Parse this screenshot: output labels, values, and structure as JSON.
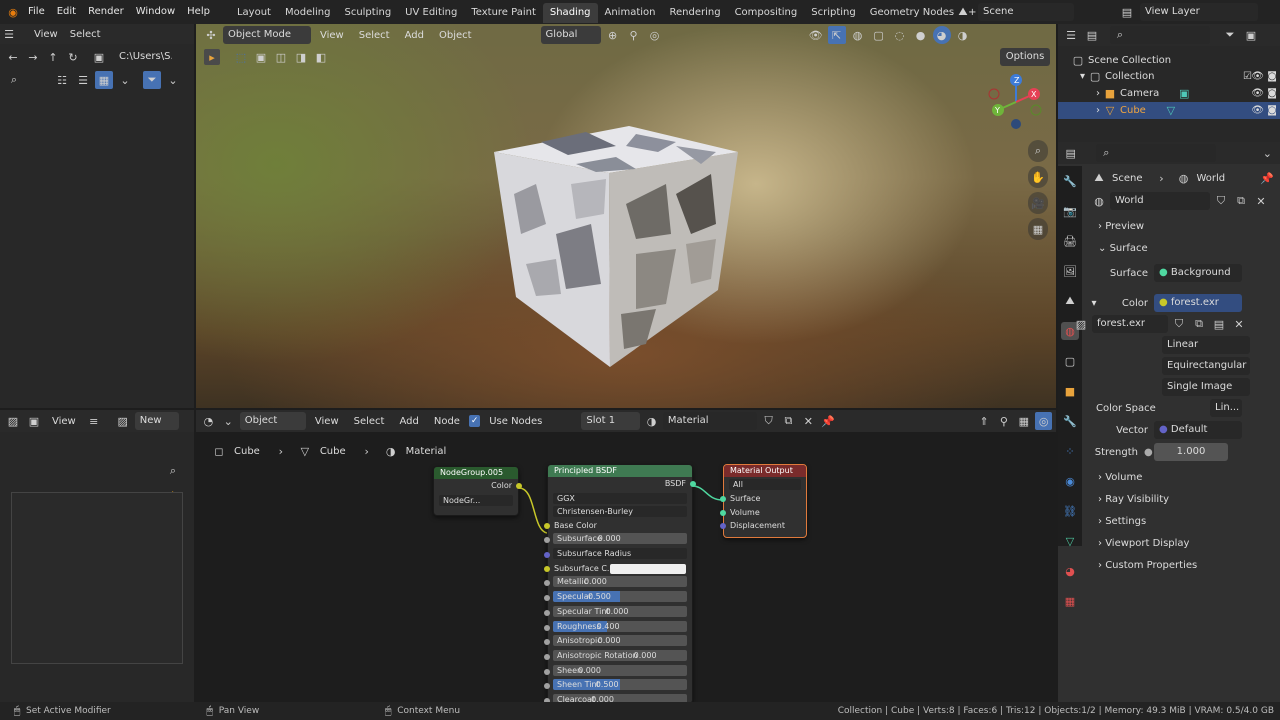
{
  "topbar": {
    "menus": [
      "File",
      "Edit",
      "Render",
      "Window",
      "Help"
    ],
    "tabs": [
      "Layout",
      "Modeling",
      "Sculpting",
      "UV Editing",
      "Texture Paint",
      "Shading",
      "Animation",
      "Rendering",
      "Compositing",
      "Scripting",
      "Geometry Nodes"
    ],
    "active_tab": "Shading",
    "add": "+",
    "scene": "Scene",
    "view_layer": "View Layer"
  },
  "filebrowser": {
    "menu": [
      "View",
      "Select"
    ],
    "path": "C:\\Users\\S..."
  },
  "viewport": {
    "mode": "Object Mode",
    "menus": [
      "View",
      "Select",
      "Add",
      "Object"
    ],
    "orientation": "Global",
    "options": "Options",
    "axis": {
      "x": "X",
      "y": "Y",
      "z": "Z"
    }
  },
  "imageeditor": {
    "view": "View",
    "new": "New"
  },
  "nodeeditor": {
    "type": "Object",
    "menus": [
      "View",
      "Select",
      "Add",
      "Node"
    ],
    "use_nodes": "Use Nodes",
    "slot": "Slot 1",
    "material": "Material",
    "breadcrumb": [
      "Cube",
      "Cube",
      "Material"
    ]
  },
  "nodes": {
    "group": {
      "title": "NodeGroup.005",
      "out": "Color",
      "sel": "NodeGr..."
    },
    "bsdf": {
      "title": "Principled BSDF",
      "out": "BSDF",
      "dist": "GGX",
      "sss": "Christensen-Burley",
      "base": "Base Color",
      "rows": [
        {
          "l": "Subsurface",
          "v": "0.000",
          "f": 0
        },
        {
          "l": "Subsurface Radius",
          "v": "",
          "f": -1
        },
        {
          "l": "Subsurface C...",
          "v": "",
          "f": -2
        },
        {
          "l": "Metallic",
          "v": "0.000",
          "f": 0
        },
        {
          "l": "Specular",
          "v": "0.500",
          "f": 0.5
        },
        {
          "l": "Specular Tint",
          "v": "0.000",
          "f": 0
        },
        {
          "l": "Roughness",
          "v": "0.400",
          "f": 0.4
        },
        {
          "l": "Anisotropic",
          "v": "0.000",
          "f": 0
        },
        {
          "l": "Anisotropic Rotation",
          "v": "0.000",
          "f": 0
        },
        {
          "l": "Sheen",
          "v": "0.000",
          "f": 0
        },
        {
          "l": "Sheen Tint",
          "v": "0.500",
          "f": 0.5
        },
        {
          "l": "Clearcoat",
          "v": "0.000",
          "f": 0
        }
      ]
    },
    "output": {
      "title": "Material Output",
      "target": "All",
      "inputs": [
        "Surface",
        "Volume",
        "Displacement"
      ]
    }
  },
  "outliner": {
    "root": "Scene Collection",
    "items": [
      {
        "label": "Collection"
      },
      {
        "label": "Camera"
      },
      {
        "label": "Cube"
      }
    ]
  },
  "properties": {
    "breadcrumb_scene": "Scene",
    "breadcrumb_world": "World",
    "world": "World",
    "sections_top": [
      "Preview",
      "Surface"
    ],
    "surface_label": "Surface",
    "surface_value": "Background",
    "color_label": "Color",
    "color_value": "forest.exr",
    "image_name": "forest.exr",
    "interp": "Linear",
    "proj": "Equirectangular",
    "source": "Single Image",
    "colorspace_label": "Color Space",
    "colorspace_value": "Lin...",
    "vector_label": "Vector",
    "vector_value": "Default",
    "strength_label": "Strength",
    "strength_value": "1.000",
    "sections_bottom": [
      "Volume",
      "Ray Visibility",
      "Settings",
      "Viewport Display",
      "Custom Properties"
    ]
  },
  "status": {
    "left": "Set Active Modifier",
    "mid": "Pan View",
    "ctx": "Context Menu",
    "right": "Collection | Cube | Verts:8 | Faces:6 | Tris:12 | Objects:1/2 | Memory: 49.3 MiB | VRAM: 0.5/4.0 GB"
  }
}
